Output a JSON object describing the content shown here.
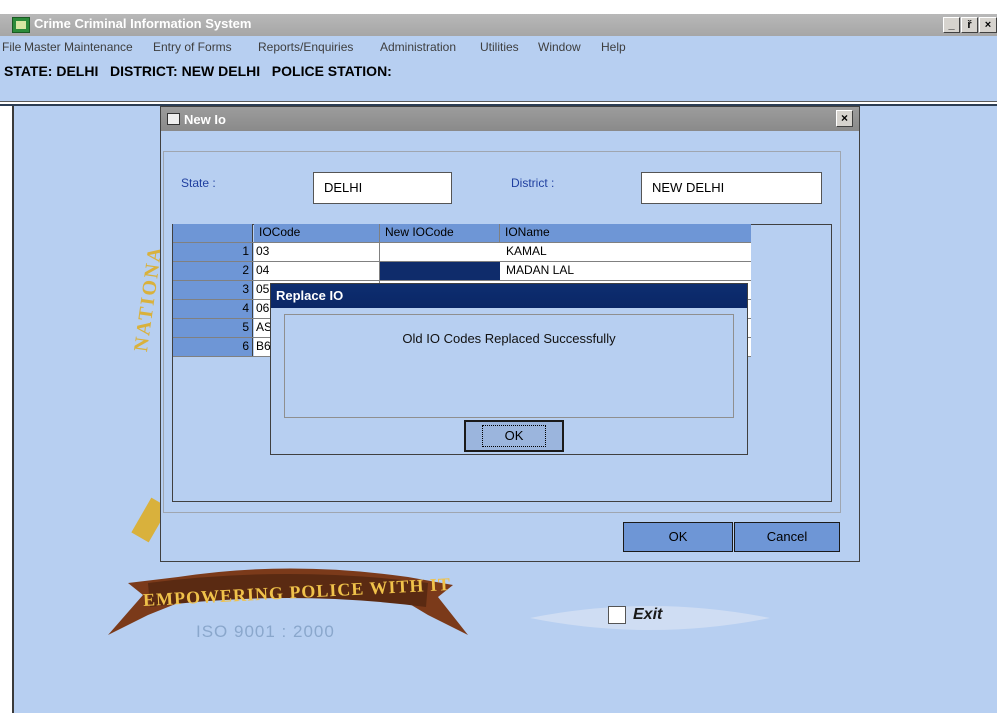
{
  "window": {
    "title": "Crime Criminal Information System",
    "controls": [
      "_",
      "ř",
      "×"
    ]
  },
  "menu": [
    "File",
    "Master Maintenance",
    "Entry of Forms",
    "Reports/Enquiries",
    "Administration",
    "Utilities",
    "Window",
    "Help"
  ],
  "info_bar": "STATE: DELHI   DISTRICT: NEW DELHI   POLICE STATION:",
  "background": {
    "ribbon_text": "EMPOWERING POLICE WITH IT",
    "iso_text": "ISO 9001 : 2000",
    "seal_text": "NATIONA",
    "exit_label": "Exit"
  },
  "new_io_dialog": {
    "title": "New Io",
    "close": "×",
    "state_label": "State :",
    "state_value": "DELHI",
    "district_label": "District :",
    "district_value": "NEW DELHI",
    "grid": {
      "headers": [
        "",
        "IOCode",
        "New IOCode",
        "IOName"
      ],
      "rows": [
        {
          "num": "1",
          "code": "03",
          "new_code": "",
          "name": "KAMAL"
        },
        {
          "num": "2",
          "code": "04",
          "new_code": "",
          "name": "MADAN LAL"
        },
        {
          "num": "3",
          "code": "05",
          "new_code": "",
          "name": ""
        },
        {
          "num": "4",
          "code": "06",
          "new_code": "",
          "name": ""
        },
        {
          "num": "5",
          "code": "AS",
          "new_code": "",
          "name": ""
        },
        {
          "num": "6",
          "code": "B6",
          "new_code": "",
          "name": ""
        }
      ]
    },
    "ok_label": "OK",
    "cancel_label": "Cancel"
  },
  "replace_dialog": {
    "title": "Replace IO",
    "message": "Old IO Codes Replaced Successfully",
    "ok_label": "OK"
  },
  "colors": {
    "background": "#b7cff1",
    "grid_header": "#6e96d6",
    "selection": "#0f2c6b",
    "active_title": "#0e2e70"
  }
}
